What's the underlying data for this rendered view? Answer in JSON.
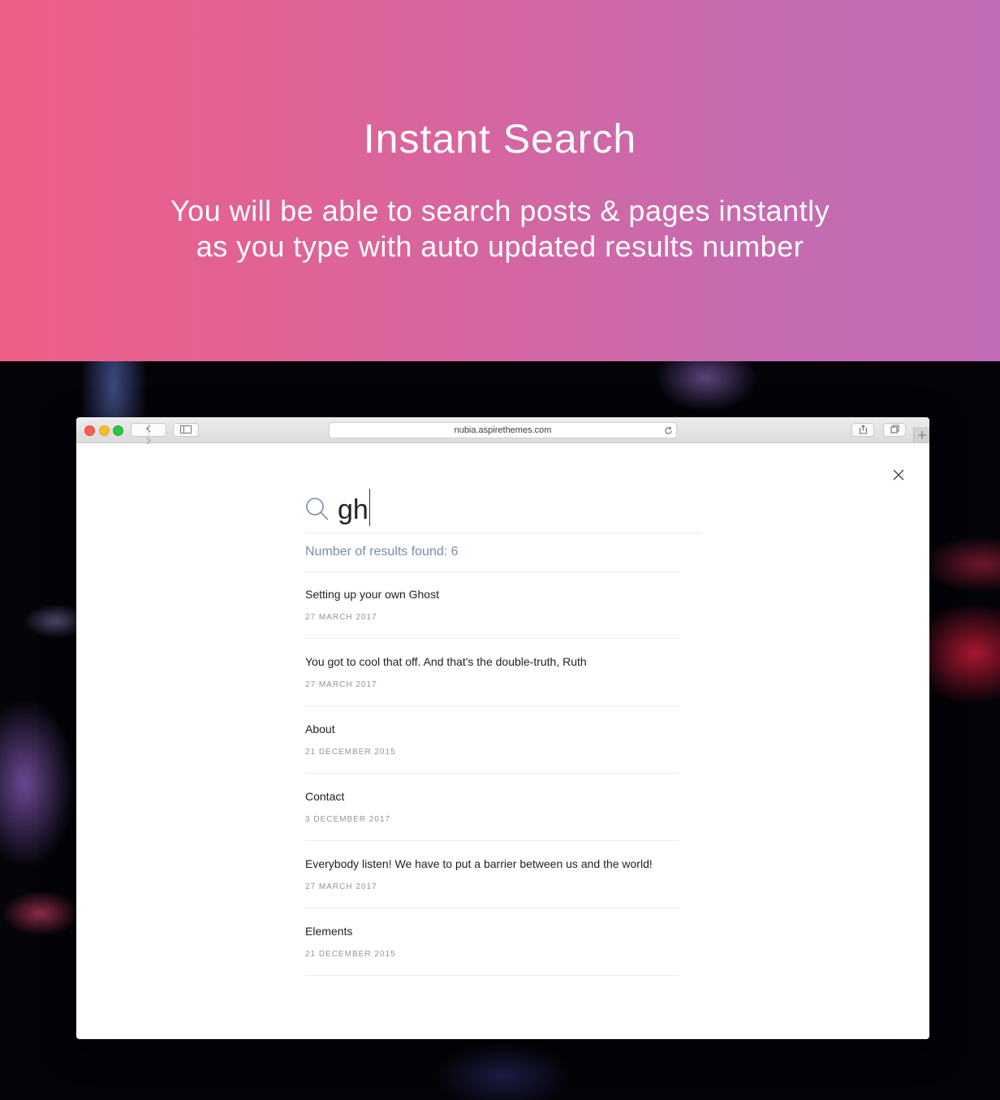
{
  "hero": {
    "title": "Instant Search",
    "subtitle_line1": "You will be able to search posts & pages instantly",
    "subtitle_line2": "as you type with auto updated results number"
  },
  "browser": {
    "url": "nubia.aspirethemes.com",
    "back_icon": "chevron-left-icon",
    "forward_icon": "chevron-right-icon",
    "reload_icon": "reload-icon",
    "share_icon": "share-icon",
    "tabs_icon": "tabs-icon",
    "newtab_icon": "plus-icon"
  },
  "search": {
    "query": "gh",
    "count_label": "Number of results found: 6",
    "results": [
      {
        "title": "Setting up your own Ghost",
        "date": "27 March 2017"
      },
      {
        "title": "You got to cool that off. And that's the double-truth, Ruth",
        "date": "27 March 2017"
      },
      {
        "title": "About",
        "date": "21 December 2015"
      },
      {
        "title": "Contact",
        "date": "3 December 2017"
      },
      {
        "title": "Everybody listen! We have to put a barrier between us and the world!",
        "date": "27 March 2017"
      },
      {
        "title": "Elements",
        "date": "21 December 2015"
      }
    ]
  },
  "colors": {
    "hero_gradient_start": "#ee5f86",
    "hero_gradient_end": "#c16ab5",
    "count_text": "#7b8ba3",
    "date_text": "#8e95a5"
  }
}
